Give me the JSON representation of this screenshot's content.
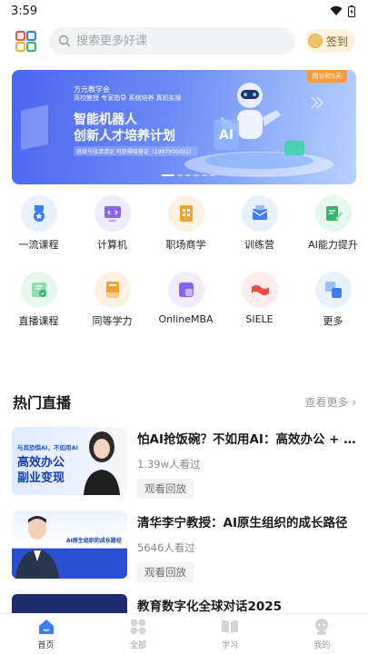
{
  "status_bar": {
    "time": "3:59"
  },
  "search": {
    "placeholder": "搜索更多好课"
  },
  "signin": {
    "label": "签到"
  },
  "banner": {
    "org": "方元教学会",
    "tags": "高校教授 专家指导 系统培养 真机实操",
    "title_line1": "智能机器人",
    "title_line2": "创新人才培养计划",
    "code": "班级号段请请证 可获得结营证（1997930001）",
    "badge": "倒计时5天"
  },
  "categories": [
    {
      "label": "一流课程",
      "icon": "medal-icon"
    },
    {
      "label": "计算机",
      "icon": "computer-icon"
    },
    {
      "label": "职场商学",
      "icon": "building-icon"
    },
    {
      "label": "训练营",
      "icon": "envelope-icon"
    },
    {
      "label": "AI能力提升",
      "icon": "pencil-note-icon"
    },
    {
      "label": "直播课程",
      "icon": "live-icon"
    },
    {
      "label": "同等学力",
      "icon": "book-icon"
    },
    {
      "label": "OnlineMBA",
      "icon": "mba-icon"
    },
    {
      "label": "SIELE",
      "icon": "flag-icon"
    },
    {
      "label": "更多",
      "icon": "more-squares-icon"
    }
  ],
  "section": {
    "title": "热门直播",
    "more": "查看更多"
  },
  "lives": [
    {
      "title": "怕AI抢饭碗？不如用AI：高效办公 + 副业变现",
      "views": "1.39w人看过",
      "action": "观看回放",
      "thumb_text1": "与其恐惧AI，不如用AI",
      "thumb_text2": "高效办公",
      "thumb_text3": "副业变现"
    },
    {
      "title": "清华李宁教授：AI原生组织的成长路径",
      "views": "5646人看过",
      "action": "观看回放",
      "thumb_text1": "AI原生组织的成长路径"
    },
    {
      "title": "教育数字化全球对话2025",
      "views": "",
      "action": ""
    }
  ],
  "tabs": [
    {
      "label": "首页",
      "active": true
    },
    {
      "label": "全部",
      "active": false
    },
    {
      "label": "学习",
      "active": false
    },
    {
      "label": "我的",
      "active": false
    }
  ],
  "colors": {
    "accent": "#3d7bf7",
    "banner": "#4a66f0"
  }
}
